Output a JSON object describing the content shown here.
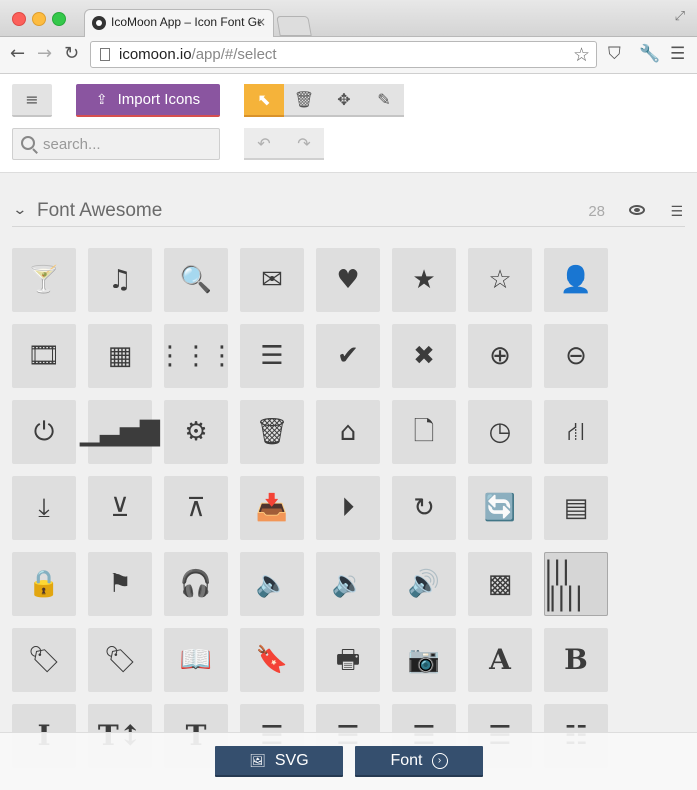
{
  "browser": {
    "tab_title": "IcoMoon App – Icon Font Generator",
    "tab_close": "×",
    "url_host": "icomoon.io",
    "url_path": "/app/#/select",
    "icons": [
      "back-arrow",
      "forward-arrow",
      "reload",
      "page",
      "bookmark-star",
      "pocket",
      "wrench",
      "menu"
    ]
  },
  "appbar": {
    "menu_label": "≡",
    "import_label": "Import Icons",
    "tools": [
      {
        "name": "select-cursor",
        "glyph": "⬉",
        "active": true
      },
      {
        "name": "trash",
        "glyph": "🗑"
      },
      {
        "name": "move",
        "glyph": "✥"
      },
      {
        "name": "pencil",
        "glyph": "✎"
      }
    ],
    "search_placeholder": "search...",
    "undo_glyph": "↶",
    "redo_glyph": "↷",
    "accent_color": "#f5b33a",
    "import_color": "#8a55a0"
  },
  "section": {
    "title": "Font Awesome",
    "count": "28"
  },
  "icons": [
    {
      "name": "glass",
      "glyph": "🍸"
    },
    {
      "name": "music",
      "glyph": "♫"
    },
    {
      "name": "search",
      "glyph": "🔍"
    },
    {
      "name": "envelope",
      "glyph": "✉"
    },
    {
      "name": "heart",
      "glyph": "♥"
    },
    {
      "name": "star",
      "glyph": "★"
    },
    {
      "name": "star-empty",
      "glyph": "☆"
    },
    {
      "name": "user",
      "glyph": "👤"
    },
    {
      "name": "film",
      "glyph": "🎞"
    },
    {
      "name": "th-large",
      "glyph": "▦"
    },
    {
      "name": "th",
      "glyph": "⋮⋮⋮"
    },
    {
      "name": "th-list",
      "glyph": "☰"
    },
    {
      "name": "ok",
      "glyph": "✔"
    },
    {
      "name": "remove",
      "glyph": "✖"
    },
    {
      "name": "zoom-in",
      "glyph": "⊕"
    },
    {
      "name": "zoom-out",
      "glyph": "⊖"
    },
    {
      "name": "off",
      "glyph": "⏻"
    },
    {
      "name": "signal",
      "glyph": "▁▃▅▇"
    },
    {
      "name": "cog",
      "glyph": "⚙"
    },
    {
      "name": "trash",
      "glyph": "🗑"
    },
    {
      "name": "home",
      "glyph": "⌂"
    },
    {
      "name": "file",
      "glyph": "🗋"
    },
    {
      "name": "time",
      "glyph": "◷"
    },
    {
      "name": "road",
      "glyph": "⛙"
    },
    {
      "name": "download-alt",
      "glyph": "⤓"
    },
    {
      "name": "download",
      "glyph": "⊻"
    },
    {
      "name": "upload",
      "glyph": "⊼"
    },
    {
      "name": "inbox",
      "glyph": "📥"
    },
    {
      "name": "play-circle",
      "glyph": "⏵"
    },
    {
      "name": "repeat",
      "glyph": "↻"
    },
    {
      "name": "refresh",
      "glyph": "🔄"
    },
    {
      "name": "list-alt",
      "glyph": "▤"
    },
    {
      "name": "lock",
      "glyph": "🔒"
    },
    {
      "name": "flag",
      "glyph": "⚑"
    },
    {
      "name": "headphones",
      "glyph": "🎧"
    },
    {
      "name": "volume-off",
      "glyph": "🔈"
    },
    {
      "name": "volume-down",
      "glyph": "🔉"
    },
    {
      "name": "volume-up",
      "glyph": "🔊"
    },
    {
      "name": "qrcode",
      "glyph": "▩"
    },
    {
      "name": "barcode",
      "glyph": "|||‖|||",
      "selected": true
    },
    {
      "name": "tag",
      "glyph": "🏷"
    },
    {
      "name": "tags",
      "glyph": "🏷"
    },
    {
      "name": "book",
      "glyph": "📖"
    },
    {
      "name": "bookmark",
      "glyph": "🔖"
    },
    {
      "name": "print",
      "glyph": "🖶"
    },
    {
      "name": "camera",
      "glyph": "📷"
    },
    {
      "name": "font",
      "glyph": "A",
      "serif": true
    },
    {
      "name": "bold",
      "glyph": "B",
      "serif": true
    },
    {
      "name": "italic",
      "glyph": "I",
      "serif": true
    },
    {
      "name": "text-height",
      "glyph": "T↕",
      "serif": true
    },
    {
      "name": "text-width",
      "glyph": "T",
      "serif": true
    },
    {
      "name": "align-left",
      "glyph": "☰"
    },
    {
      "name": "align-center",
      "glyph": "☰"
    },
    {
      "name": "align-right",
      "glyph": "☰"
    },
    {
      "name": "align-justify",
      "glyph": "☰"
    },
    {
      "name": "list",
      "glyph": "☷"
    }
  ],
  "footer": {
    "svg_label": "SVG",
    "font_label": "Font",
    "button_color": "#354f6e"
  }
}
